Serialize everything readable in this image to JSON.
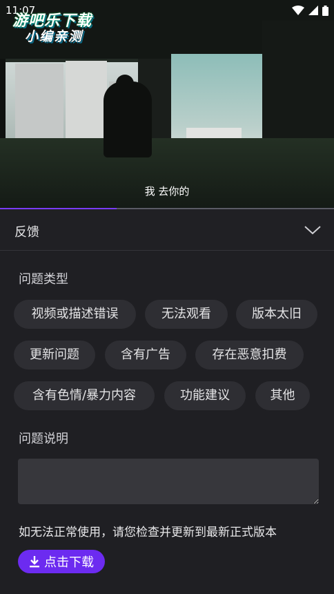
{
  "status_bar": {
    "time": "11:07"
  },
  "watermark": {
    "line1": "游吧乐下载",
    "line2": "小编亲测"
  },
  "video": {
    "subtitle": "我 去你的",
    "progress": 0.35
  },
  "panel": {
    "title": "反馈",
    "problem_type_label": "问题类型",
    "chips": [
      "视频或描述错误",
      "无法观看",
      "版本太旧",
      "更新问题",
      "含有广告",
      "存在恶意扣费",
      "含有色情/暴力内容",
      "功能建议",
      "其他"
    ],
    "description_label": "问题说明",
    "description_value": "",
    "notice": "如无法正常使用，请您检查并更新到最新正式版本",
    "download_label": "点击下载"
  },
  "colors": {
    "accent": "#6c2bf0",
    "background": "#1f1f23",
    "chip": "#2e2e33"
  },
  "icons": [
    "wifi-icon",
    "signal-icon",
    "battery-icon",
    "chevron-down-icon",
    "download-icon"
  ]
}
